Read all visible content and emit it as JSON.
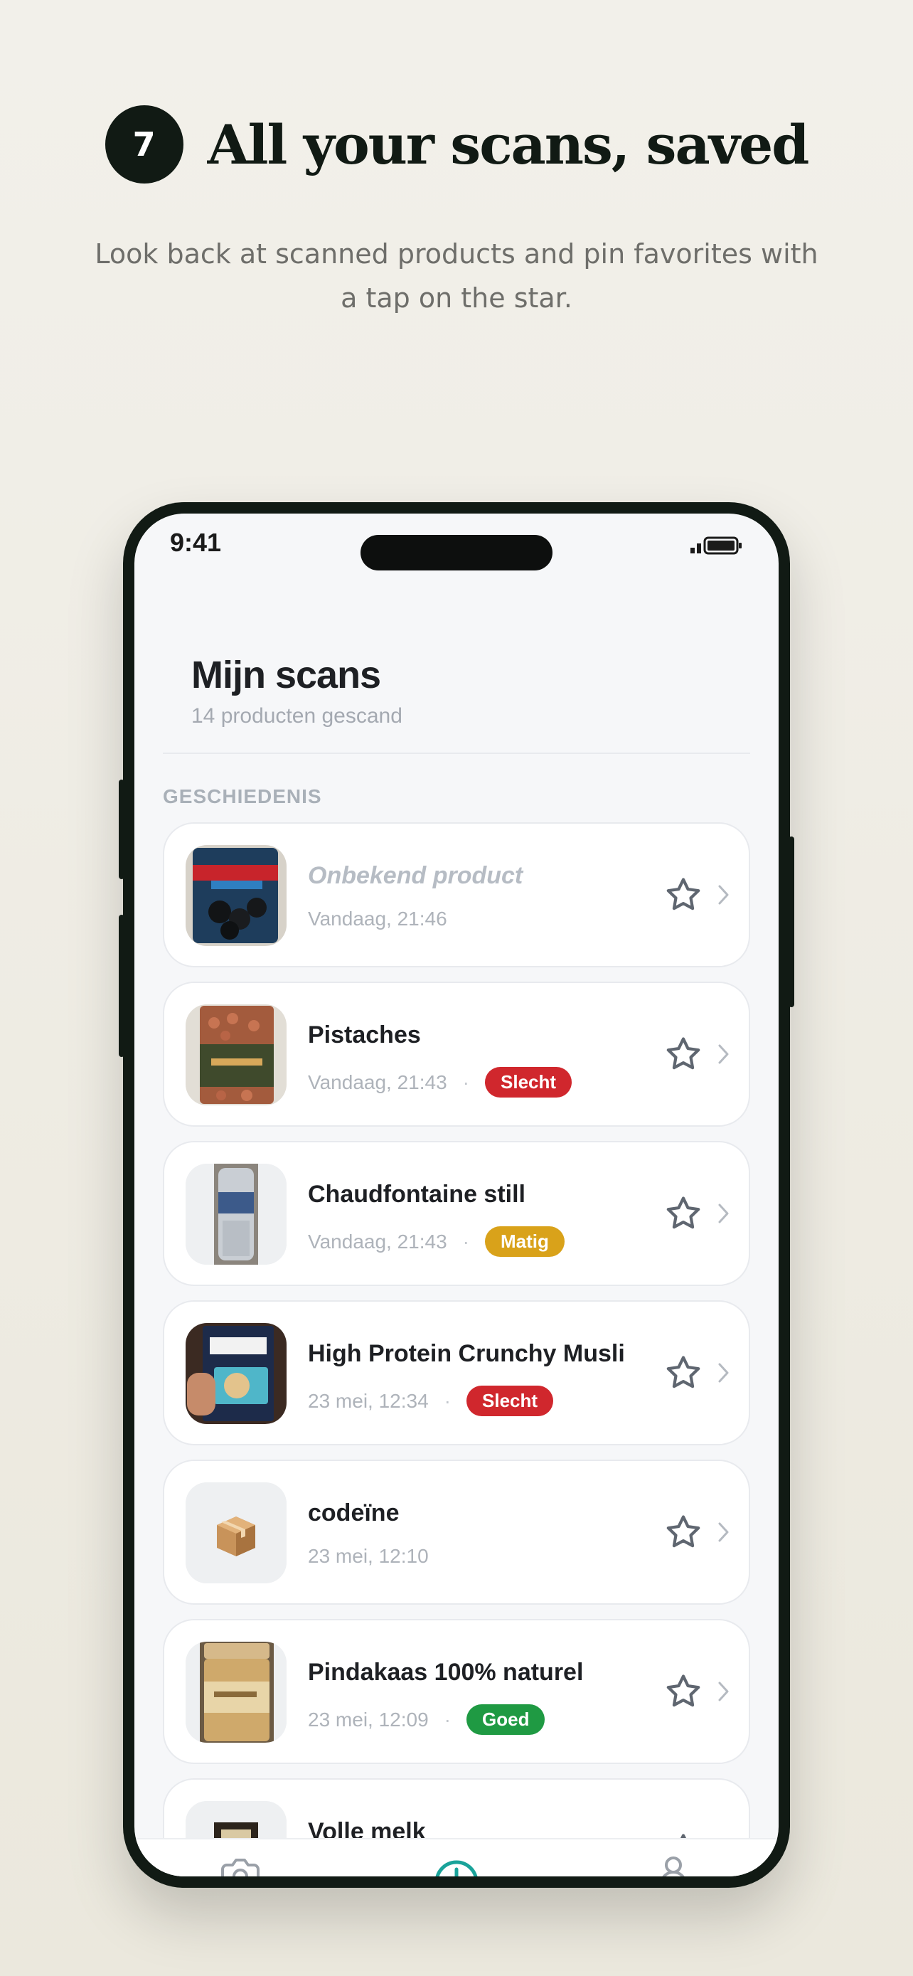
{
  "hero": {
    "step": "7",
    "heading": "All your scans, saved",
    "subtitle": "Look back at scanned products and pin favorites with a tap on the star."
  },
  "status_bar": {
    "time": "9:41"
  },
  "screen": {
    "title": "Mijn scans",
    "subtitle": "14 producten gescand",
    "section_label": "GESCHIEDENIS"
  },
  "colors": {
    "slecht": "#d0272d",
    "matig": "#d9a21a",
    "goed": "#1f9a43",
    "accent": "#1aa39a"
  },
  "scans": [
    {
      "name": "Onbekend product",
      "time": "Vandaag, 21:46",
      "rating": "",
      "thumb": "venco-bag"
    },
    {
      "name": "Pistaches",
      "time": "Vandaag, 21:43",
      "rating": "Slecht",
      "thumb": "pistachio-bag"
    },
    {
      "name": "Chaudfontaine still",
      "time": "Vandaag, 21:43",
      "rating": "Matig",
      "thumb": "water-bottle"
    },
    {
      "name": "High Protein Crunchy Musli",
      "time": "23 mei, 12:34",
      "rating": "Slecht",
      "thumb": "musli-box"
    },
    {
      "name": "codeïne",
      "time": "23 mei, 12:10",
      "rating": "",
      "thumb": "package-icon"
    },
    {
      "name": "Pindakaas 100% naturel",
      "time": "23 mei, 12:09",
      "rating": "Goed",
      "thumb": "peanut-jar"
    },
    {
      "name": "Volle melk",
      "time": "",
      "rating": "",
      "thumb": "milk-carton"
    }
  ],
  "tabs": [
    {
      "icon": "camera-icon"
    },
    {
      "icon": "history-icon",
      "active": true
    },
    {
      "icon": "profile-icon"
    }
  ]
}
